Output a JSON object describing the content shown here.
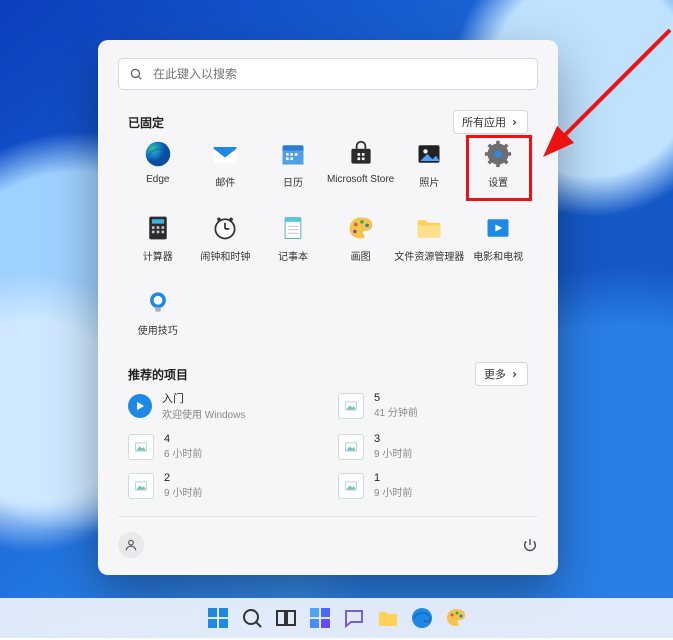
{
  "search": {
    "placeholder": "在此键入以搜索"
  },
  "pinned": {
    "title": "已固定",
    "all_apps_label": "所有应用",
    "apps": [
      {
        "id": "edge",
        "label": "Edge"
      },
      {
        "id": "mail",
        "label": "邮件"
      },
      {
        "id": "calendar",
        "label": "日历"
      },
      {
        "id": "store",
        "label": "Microsoft Store"
      },
      {
        "id": "photos",
        "label": "照片"
      },
      {
        "id": "settings",
        "label": "设置"
      },
      {
        "id": "calculator",
        "label": "计算器"
      },
      {
        "id": "clock",
        "label": "闹钟和时钟"
      },
      {
        "id": "notepad",
        "label": "记事本"
      },
      {
        "id": "paint",
        "label": "画图"
      },
      {
        "id": "explorer",
        "label": "文件资源管理器"
      },
      {
        "id": "movies",
        "label": "电影和电视"
      },
      {
        "id": "tips",
        "label": "使用技巧"
      }
    ]
  },
  "recommended": {
    "title": "推荐的项目",
    "more_label": "更多",
    "items": [
      {
        "title": "入门",
        "subtitle": "欢迎使用 Windows",
        "thumb": "tips"
      },
      {
        "title": "5",
        "subtitle": "41 分钟前",
        "thumb": "img"
      },
      {
        "title": "4",
        "subtitle": "6 小时前",
        "thumb": "img"
      },
      {
        "title": "3",
        "subtitle": "9 小时前",
        "thumb": "img"
      },
      {
        "title": "2",
        "subtitle": "9 小时前",
        "thumb": "img"
      },
      {
        "title": "1",
        "subtitle": "9 小时前",
        "thumb": "img"
      }
    ]
  },
  "highlight_app": "settings"
}
